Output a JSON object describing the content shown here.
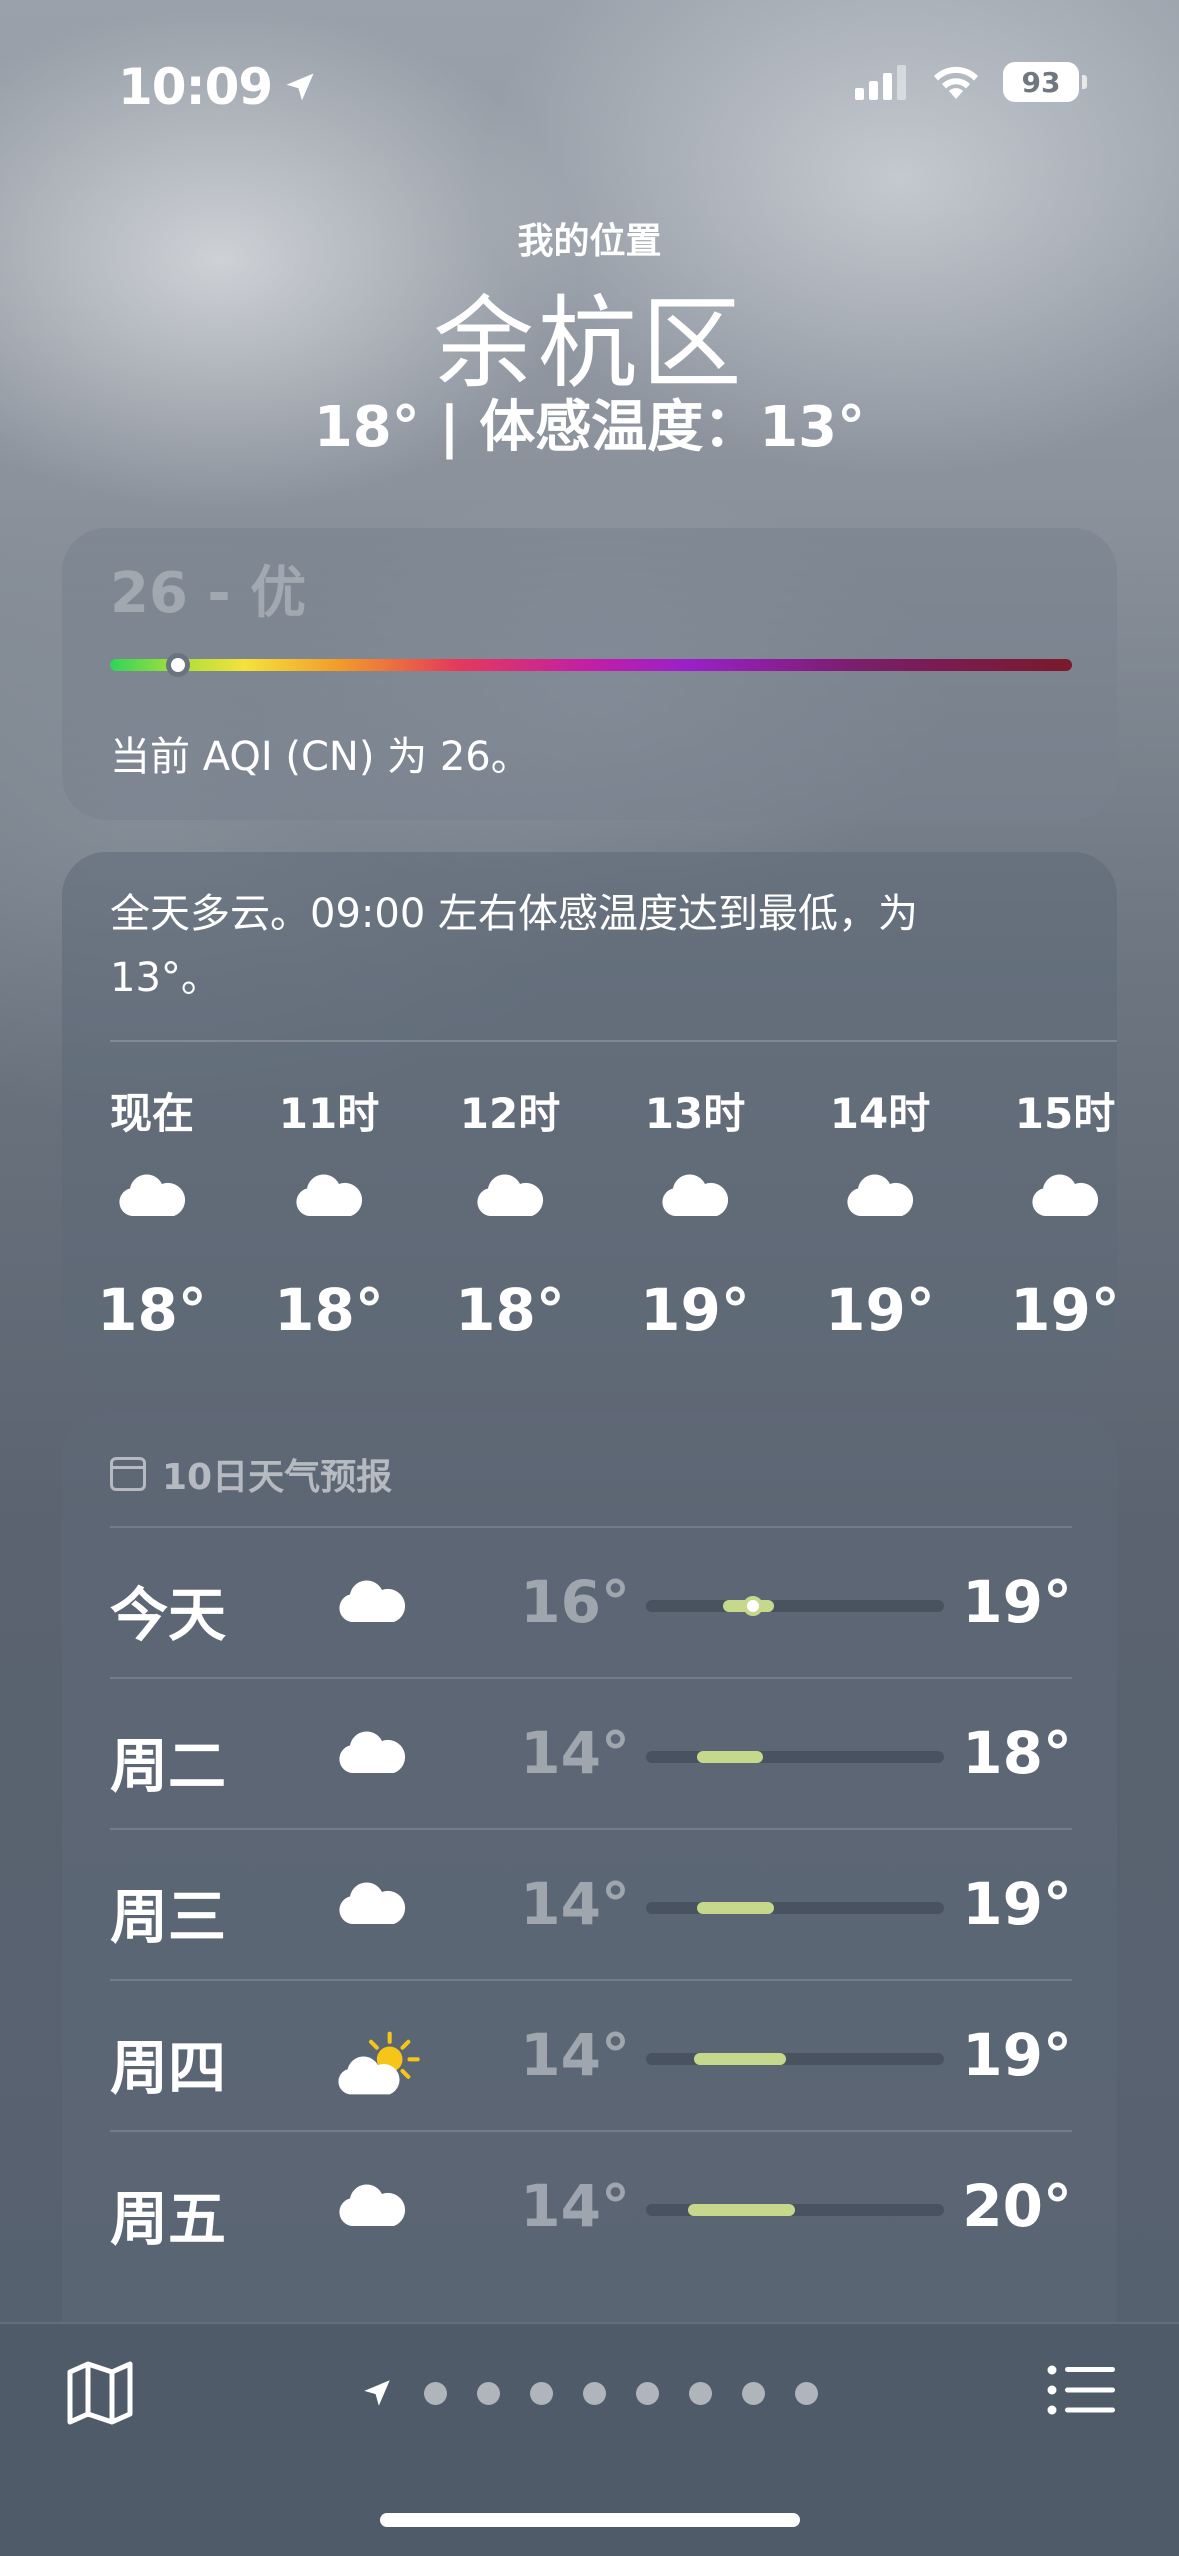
{
  "status_bar": {
    "time": "10:09",
    "battery": "93",
    "icons": [
      "location-arrow-icon",
      "signal-icon",
      "wifi-icon",
      "battery-icon"
    ]
  },
  "header": {
    "subtitle": "我的位置",
    "city": "余杭区",
    "temp_line": "18° | 体感温度：13°"
  },
  "aqi": {
    "value_label": "26 - 优",
    "description": "当前 AQI (CN) 为 26。",
    "value": 26,
    "scale_colors": [
      "#2fd45a",
      "#f5e23a",
      "#f29a2a",
      "#e43a5a",
      "#c21ea8",
      "#9a20c8",
      "#7a1a2a"
    ]
  },
  "hourly": {
    "summary": "全天多云。09:00 左右体感温度达到最低，为 13°。",
    "hours": [
      {
        "label": "现在",
        "icon": "cloud-icon",
        "temp": "18°"
      },
      {
        "label": "11时",
        "icon": "cloud-icon",
        "temp": "18°"
      },
      {
        "label": "12时",
        "icon": "cloud-icon",
        "temp": "18°"
      },
      {
        "label": "13时",
        "icon": "cloud-icon",
        "temp": "19°"
      },
      {
        "label": "14时",
        "icon": "cloud-icon",
        "temp": "19°"
      },
      {
        "label": "15时",
        "icon": "cloud-icon",
        "temp": "19°"
      }
    ]
  },
  "daily": {
    "title": "10日天气预报",
    "days": [
      {
        "name": "今天",
        "icon": "cloud-icon",
        "low": "16°",
        "high": "19°",
        "range_start": 0.26,
        "range_end": 0.43,
        "current": 0.36
      },
      {
        "name": "周二",
        "icon": "cloud-icon",
        "low": "14°",
        "high": "18°",
        "range_start": 0.17,
        "range_end": 0.39
      },
      {
        "name": "周三",
        "icon": "cloud-icon",
        "low": "14°",
        "high": "19°",
        "range_start": 0.17,
        "range_end": 0.43
      },
      {
        "name": "周四",
        "icon": "partly-sunny-icon",
        "low": "14°",
        "high": "19°",
        "range_start": 0.16,
        "range_end": 0.47
      },
      {
        "name": "周五",
        "icon": "cloud-icon",
        "low": "14°",
        "high": "20°",
        "range_start": 0.14,
        "range_end": 0.5
      }
    ]
  },
  "toolbar": {
    "page_count": 8,
    "icons": [
      "map-icon",
      "location-arrow-icon",
      "list-icon"
    ]
  }
}
